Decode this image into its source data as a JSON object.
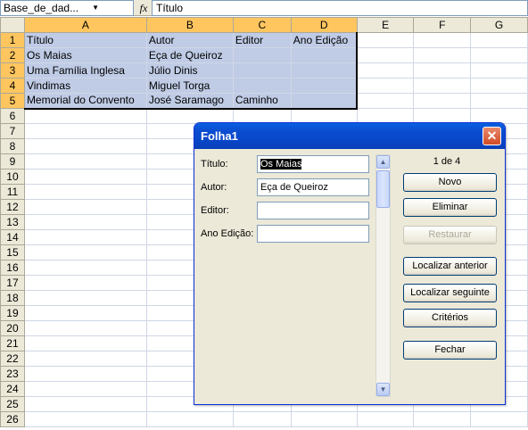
{
  "formula_bar": {
    "name_box": "Base_de_dad...",
    "formula": "Título"
  },
  "columns": [
    "A",
    "B",
    "C",
    "D",
    "E",
    "F",
    "G"
  ],
  "rows": [
    "1",
    "2",
    "3",
    "4",
    "5",
    "6",
    "7",
    "8",
    "9",
    "10",
    "11",
    "12",
    "13",
    "14",
    "15",
    "16",
    "17",
    "18",
    "19",
    "20",
    "21",
    "22",
    "23",
    "24",
    "25",
    "26"
  ],
  "sheet": {
    "header": [
      "Título",
      "Autor",
      "Editor",
      "Ano Edição"
    ],
    "records": [
      [
        "Os Maias",
        "Eça de Queiroz",
        "",
        ""
      ],
      [
        "Uma Família Inglesa",
        "Júlio Dinis",
        "",
        ""
      ],
      [
        "Vindimas",
        "Miguel Torga",
        "",
        ""
      ],
      [
        "Memorial do Convento",
        "José Saramago",
        "Caminho",
        ""
      ]
    ]
  },
  "dialog": {
    "title": "Folha1",
    "record_counter": "1 de 4",
    "fields": [
      {
        "label": "Título:",
        "value": "Os Maias"
      },
      {
        "label": "Autor:",
        "value": "Eça de Queiroz"
      },
      {
        "label": "Editor:",
        "value": ""
      },
      {
        "label": "Ano Edição:",
        "value": ""
      }
    ],
    "buttons": {
      "new": "Novo",
      "delete": "Eliminar",
      "restore": "Restaurar",
      "find_prev": "Localizar anterior",
      "find_next": "Localizar seguinte",
      "criteria": "Critérios",
      "close": "Fechar"
    }
  }
}
